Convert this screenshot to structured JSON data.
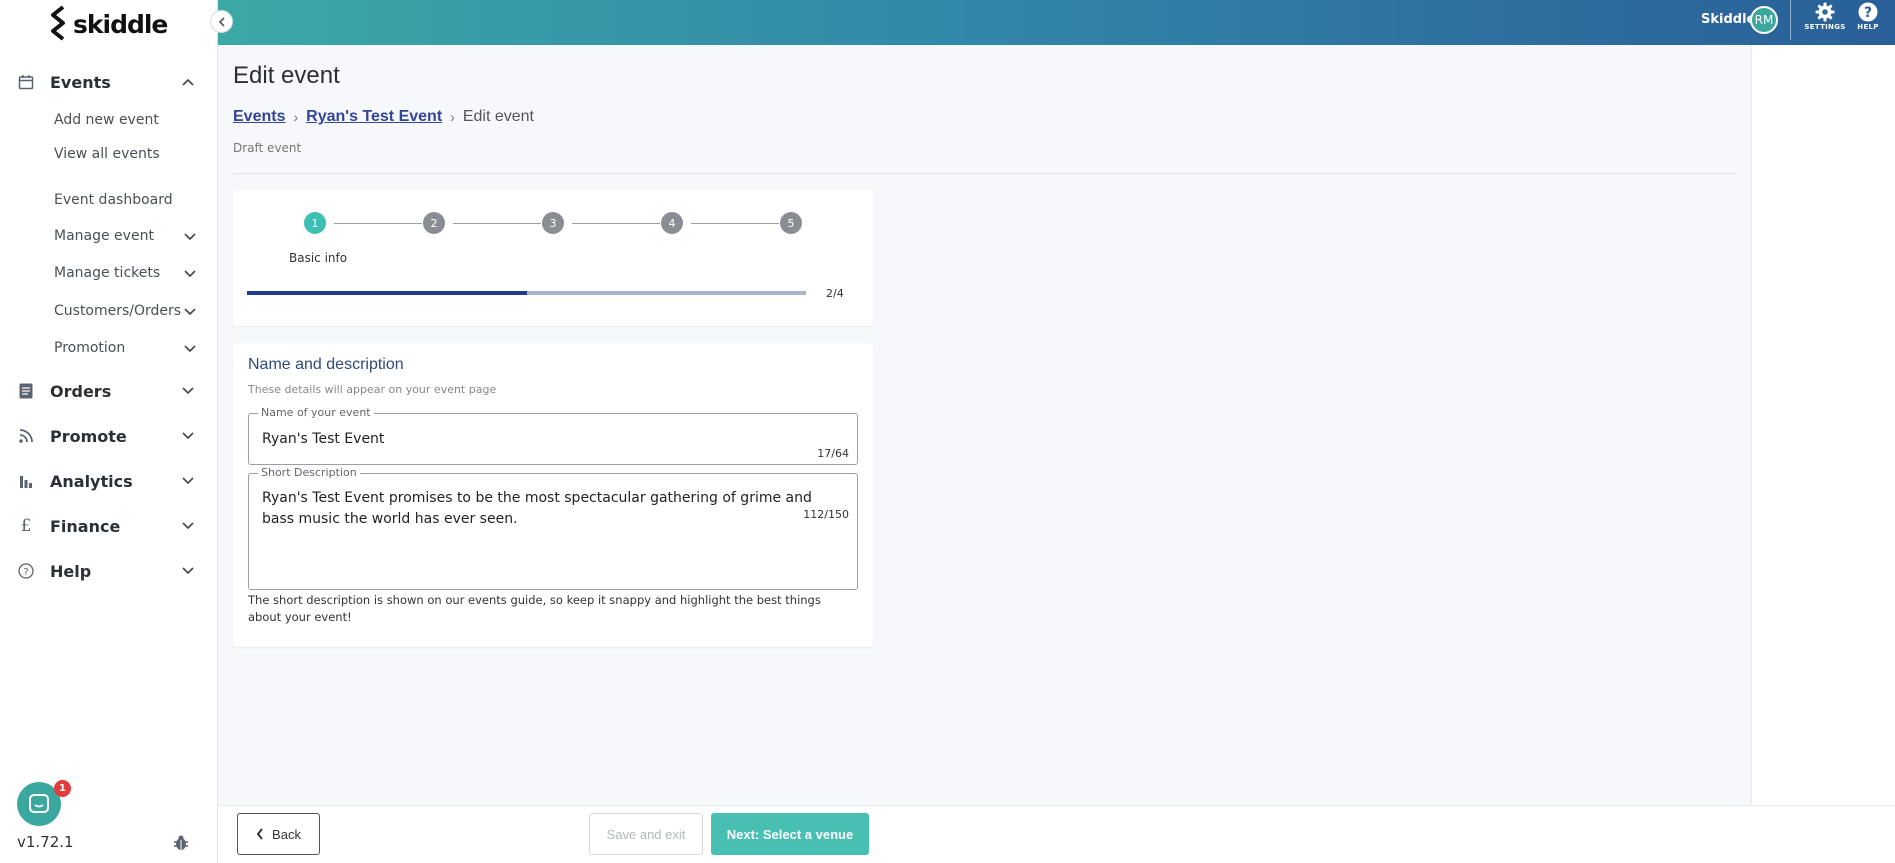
{
  "app": {
    "logo_text": "skiddle",
    "version": "v1.72.1",
    "chat_badge": "1"
  },
  "topbar": {
    "user_name": "Skiddle",
    "avatar_initials": "RM",
    "settings_label": "SETTINGS",
    "help_label": "HELP"
  },
  "sidebar": {
    "events": {
      "label": "Events",
      "icon": "calendar-icon"
    },
    "sub_items": [
      {
        "label": "Add new event"
      },
      {
        "label": "View all events"
      },
      {
        "label": "Event dashboard"
      },
      {
        "label": "Manage event"
      },
      {
        "label": "Manage tickets"
      },
      {
        "label": "Customers/Orders"
      },
      {
        "label": "Promotion"
      }
    ],
    "sections": [
      {
        "label": "Orders",
        "icon": "document-icon"
      },
      {
        "label": "Promote",
        "icon": "rss-icon"
      },
      {
        "label": "Analytics",
        "icon": "bar-chart-icon"
      },
      {
        "label": "Finance",
        "icon": "pound-icon"
      },
      {
        "label": "Help",
        "icon": "question-icon"
      }
    ]
  },
  "page": {
    "title": "Edit event",
    "breadcrumb": {
      "root": "Events",
      "event": "Ryan's Test Event",
      "current": "Edit event",
      "separator": "›"
    },
    "status": "Draft event"
  },
  "steps": {
    "numbers": [
      "1",
      "2",
      "3",
      "4",
      "5"
    ],
    "active_label": "Basic info",
    "progress_text": "2/4",
    "progress_fraction": 0.5
  },
  "form": {
    "section_title": "Name and description",
    "section_subtitle": "These details will appear on your event page",
    "name_field": {
      "legend": "Name of your event",
      "value": "Ryan's Test Event",
      "count": "17/64"
    },
    "desc_field": {
      "legend": "Short Description",
      "value": "Ryan's Test Event promises to be the most spectacular gathering of grime and bass music the world has ever seen.",
      "count": "112/150"
    },
    "helper": "The short description is shown on our events guide, so keep it snappy and highlight the best things about your event!"
  },
  "footer": {
    "back_label": "Back",
    "save_label": "Save and exit",
    "next_label": "Next: Select a venue"
  },
  "colors": {
    "accent": "#47bfb3",
    "primary_dark": "#233a8a",
    "link": "#33459a"
  }
}
